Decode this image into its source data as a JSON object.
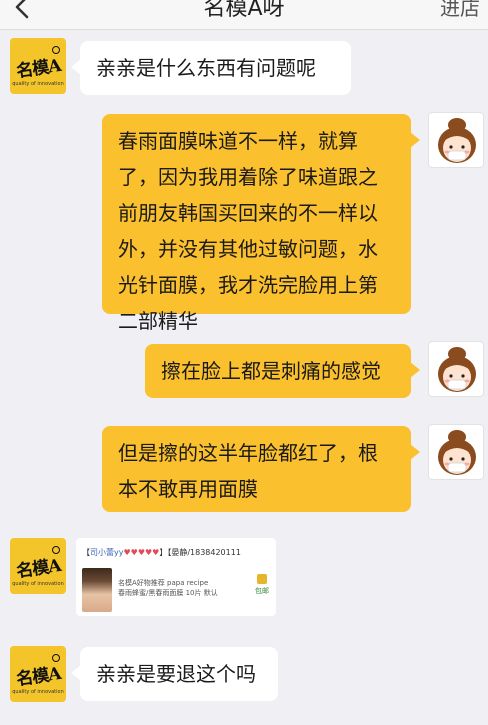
{
  "header": {
    "title": "名模A呀",
    "shop_link": "进店"
  },
  "shop": {
    "avatar_text": "名模A",
    "avatar_sub": "quality of innovation"
  },
  "messages": [
    {
      "sender": "shop",
      "text": "亲亲是什么东西有问题呢"
    },
    {
      "sender": "user",
      "lines": [
        "春雨面膜味道不一样，就算",
        "了，因为我用着除了味道跟之",
        "前朋友韩国买回来的不一样以",
        "外，并没有其他过敏问题，水",
        "光针面膜，我才洗完脸用上第",
        "二部精华"
      ]
    },
    {
      "sender": "user",
      "text": "擦在脸上都是刺痛的感觉"
    },
    {
      "sender": "user",
      "lines": [
        "但是擦的这半年脸都红了，根",
        "本不敢再用面膜"
      ]
    },
    {
      "sender": "shop",
      "text": "亲亲是要退这个吗"
    }
  ],
  "card": {
    "bracket_open": "【",
    "nick": "司小蕾yy",
    "hearts": "♥♥♥♥♥",
    "sep": "】【",
    "note": "晏静/1838420111",
    "product_line1": "名模A好物推荐 papa recipe",
    "product_line2": "春雨蜂蜜/黑春雨面膜 10片 默认",
    "tag": "包邮"
  }
}
